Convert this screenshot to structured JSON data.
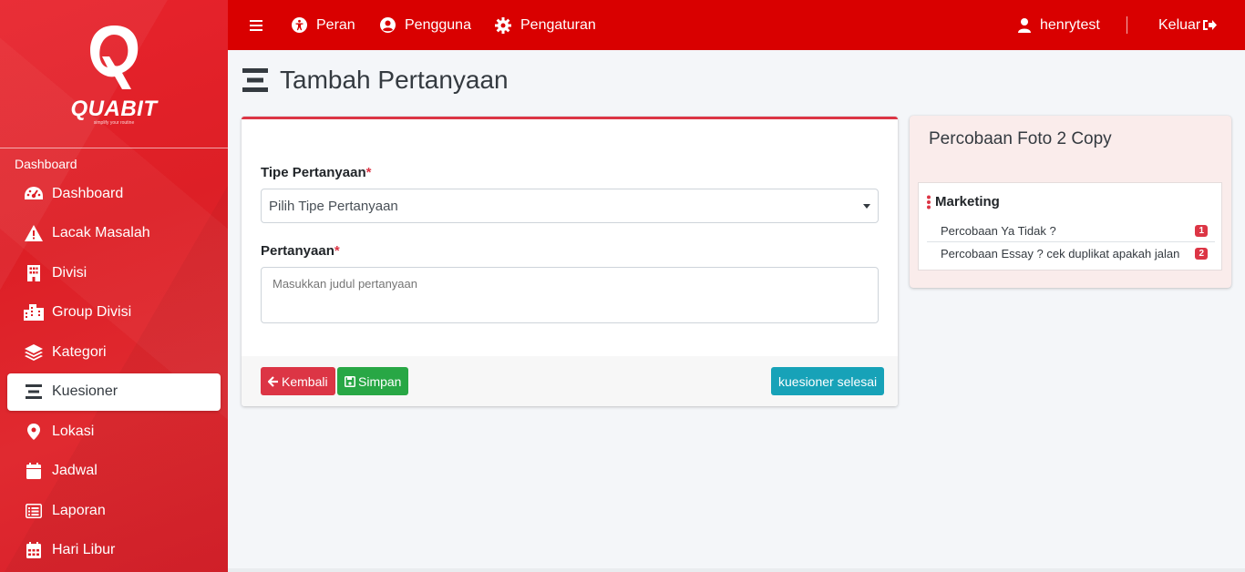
{
  "brand": {
    "name": "QUABIT",
    "tagline": "simplify your routine"
  },
  "sidebar": {
    "header": "Dashboard",
    "items": [
      {
        "label": "Dashboard",
        "icon": "tachometer-icon"
      },
      {
        "label": "Lacak Masalah",
        "icon": "warning-icon"
      },
      {
        "label": "Divisi",
        "icon": "building-icon"
      },
      {
        "label": "Group Divisi",
        "icon": "city-icon"
      },
      {
        "label": "Kategori",
        "icon": "layers-icon"
      },
      {
        "label": "Kuesioner",
        "icon": "list-icon",
        "active": true
      },
      {
        "label": "Lokasi",
        "icon": "map-marker-icon"
      },
      {
        "label": "Jadwal",
        "icon": "calendar-icon"
      },
      {
        "label": "Laporan",
        "icon": "report-list-icon"
      },
      {
        "label": "Hari Libur",
        "icon": "calendar-grid-icon"
      }
    ]
  },
  "topbar": {
    "menu_items": [
      "Peran",
      "Pengguna",
      "Pengaturan"
    ],
    "user": "henrytest",
    "logout": "Keluar"
  },
  "page": {
    "title": "Tambah Pertanyaan"
  },
  "form": {
    "type_label": "Tipe Pertanyaan",
    "type_placeholder": "Pilih Tipe Pertanyaan",
    "question_label": "Pertanyaan",
    "question_placeholder": "Masukkan judul pertanyaan",
    "required_mark": "*"
  },
  "footer": {
    "back": "Kembali",
    "save": "Simpan",
    "finish": "kuesioner selesai"
  },
  "summary": {
    "title": "Percobaan Foto 2 Copy",
    "group": "Marketing",
    "questions": [
      {
        "text": "Percobaan Ya Tidak ?",
        "number": "1"
      },
      {
        "text": "Percobaan Essay ? cek duplikat apakah jalan",
        "number": "2"
      }
    ]
  },
  "colors": {
    "primary_red": "#d90000",
    "danger": "#dc3545",
    "success": "#28a745",
    "info": "#17a2b8"
  }
}
